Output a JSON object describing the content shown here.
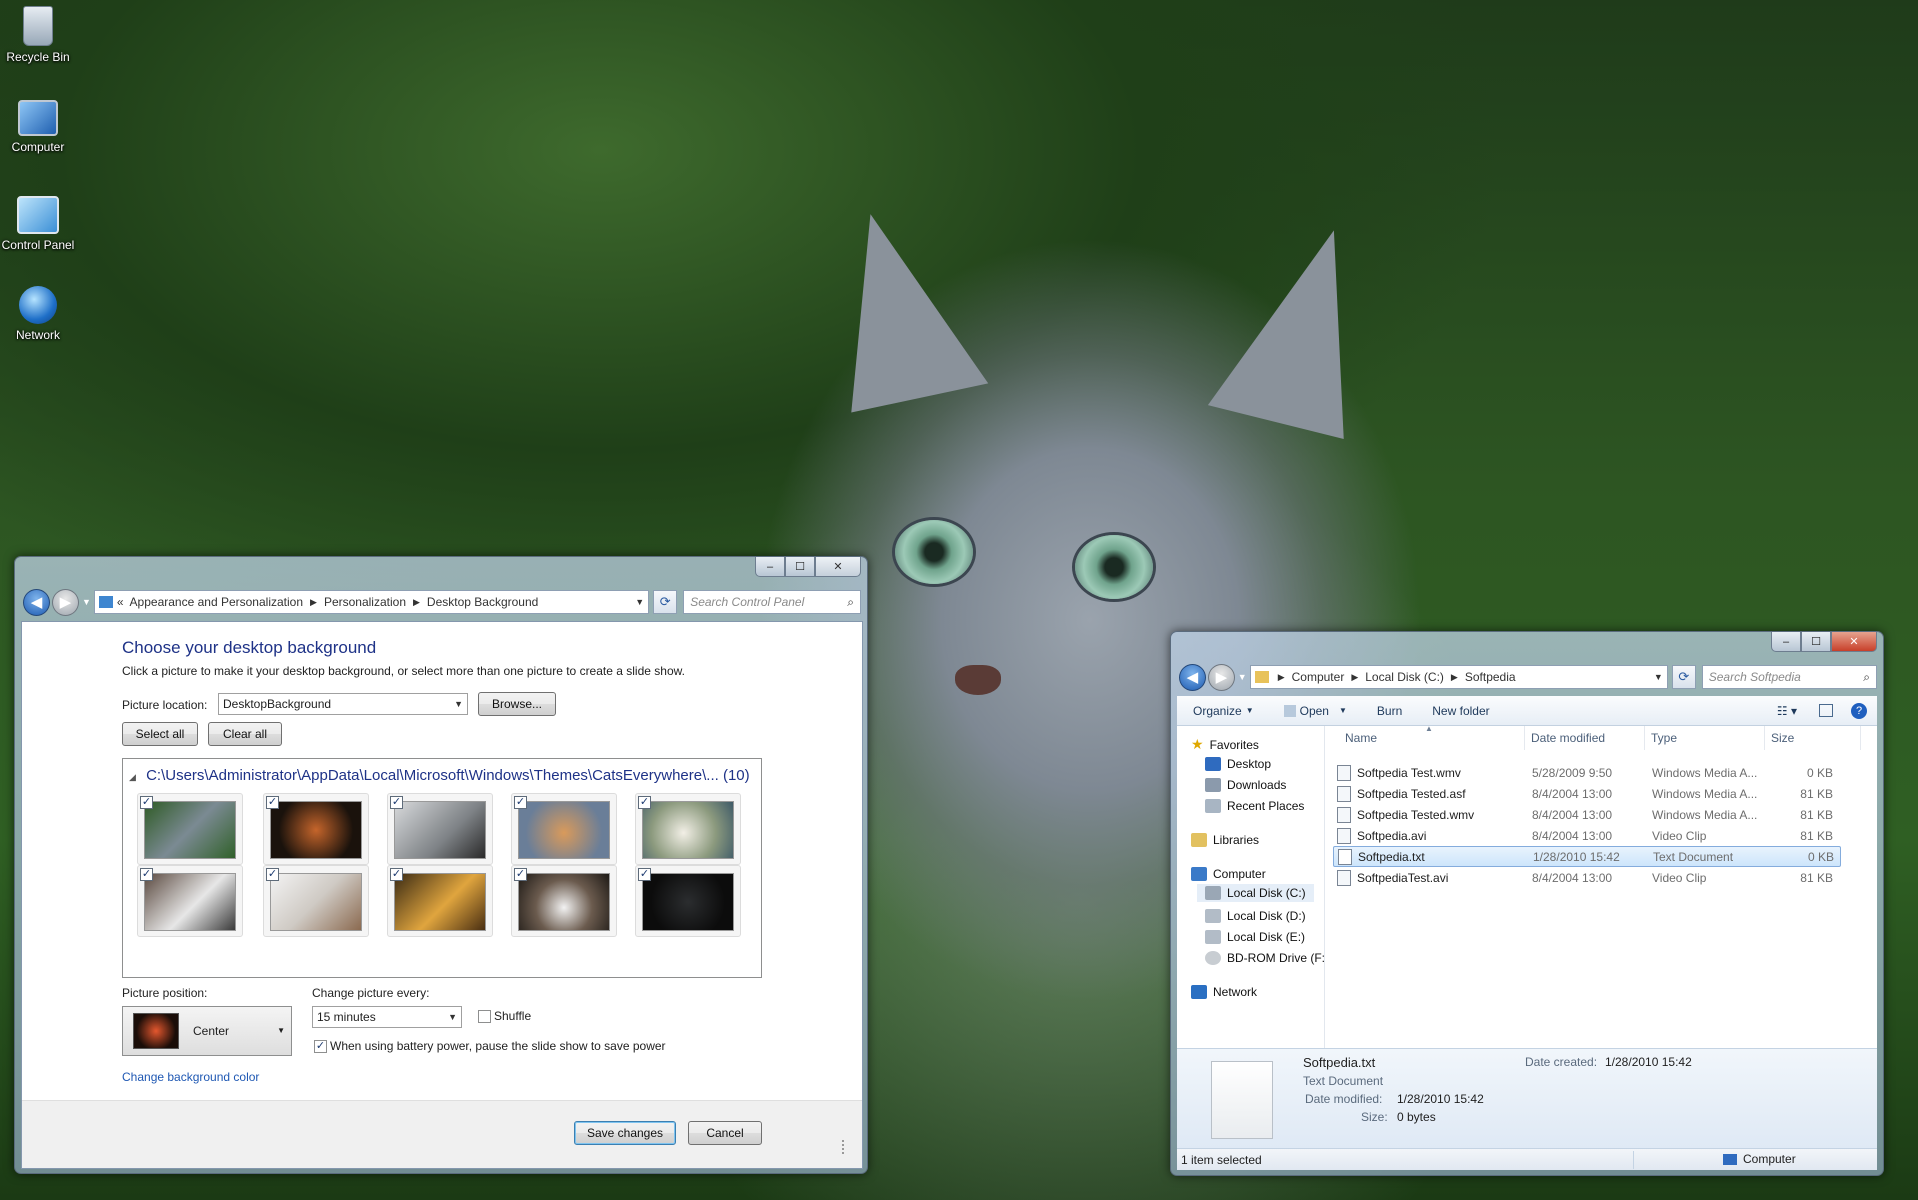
{
  "desktop_icons": [
    {
      "label": "Recycle Bin",
      "icon": "recycle-bin-icon"
    },
    {
      "label": "Computer",
      "icon": "computer-icon"
    },
    {
      "label": "Control Panel",
      "icon": "control-panel-icon"
    },
    {
      "label": "Network",
      "icon": "network-icon"
    }
  ],
  "control_panel": {
    "breadcrumb": [
      "Appearance and Personalization",
      "Personalization",
      "Desktop Background"
    ],
    "breadcrumb_prefix": "«",
    "search_placeholder": "Search Control Panel",
    "title": "Choose your desktop background",
    "description": "Click a picture to make it your desktop background, or select more than one picture to create a slide show.",
    "picture_location_label": "Picture location:",
    "picture_location_value": "DesktopBackground",
    "browse_label": "Browse...",
    "select_all_label": "Select all",
    "clear_all_label": "Clear all",
    "gallery_header": "C:\\Users\\Administrator\\AppData\\Local\\Microsoft\\Windows\\Themes\\CatsEverywhere\\... (10)",
    "thumbnails_checked": [
      true,
      true,
      true,
      true,
      true,
      true,
      true,
      true,
      true,
      true
    ],
    "picture_position_label": "Picture position:",
    "picture_position_value": "Center",
    "change_picture_label": "Change picture every:",
    "change_picture_value": "15 minutes",
    "shuffle_label": "Shuffle",
    "shuffle_checked": false,
    "battery_label": "When using battery power, pause the slide show to save power",
    "battery_checked": true,
    "change_color_link": "Change background color",
    "save_label": "Save changes",
    "cancel_label": "Cancel"
  },
  "explorer": {
    "breadcrumb": [
      "Computer",
      "Local Disk (C:)",
      "Softpedia"
    ],
    "search_placeholder": "Search Softpedia",
    "toolbar": {
      "organize": "Organize",
      "open": "Open",
      "burn": "Burn",
      "new_folder": "New folder"
    },
    "nav": {
      "favorites": "Favorites",
      "desktop": "Desktop",
      "downloads": "Downloads",
      "recent": "Recent Places",
      "libraries": "Libraries",
      "computer": "Computer",
      "disk_c": "Local Disk (C:)",
      "disk_d": "Local Disk (D:)",
      "disk_e": "Local Disk (E:)",
      "bdrom": "BD-ROM Drive (F:)",
      "network": "Network"
    },
    "columns": {
      "name": "Name",
      "date": "Date modified",
      "type": "Type",
      "size": "Size"
    },
    "files": [
      {
        "name": "Softpedia Test.wmv",
        "date": "5/28/2009 9:50",
        "type": "Windows Media A...",
        "size": "0 KB"
      },
      {
        "name": "Softpedia Tested.asf",
        "date": "8/4/2004 13:00",
        "type": "Windows Media A...",
        "size": "81 KB"
      },
      {
        "name": "Softpedia Tested.wmv",
        "date": "8/4/2004 13:00",
        "type": "Windows Media A...",
        "size": "81 KB"
      },
      {
        "name": "Softpedia.avi",
        "date": "8/4/2004 13:00",
        "type": "Video Clip",
        "size": "81 KB"
      },
      {
        "name": "Softpedia.txt",
        "date": "1/28/2010 15:42",
        "type": "Text Document",
        "size": "0 KB"
      },
      {
        "name": "SoftpediaTest.avi",
        "date": "8/4/2004 13:00",
        "type": "Video Clip",
        "size": "81 KB"
      }
    ],
    "selected_file": "Softpedia.txt",
    "details": {
      "name": "Softpedia.txt",
      "type": "Text Document",
      "date_modified_label": "Date modified:",
      "date_modified": "1/28/2010 15:42",
      "size_label": "Size:",
      "size": "0 bytes",
      "date_created_label": "Date created:",
      "date_created": "1/28/2010 15:42"
    },
    "status_left": "1 item selected",
    "status_right": "Computer"
  }
}
